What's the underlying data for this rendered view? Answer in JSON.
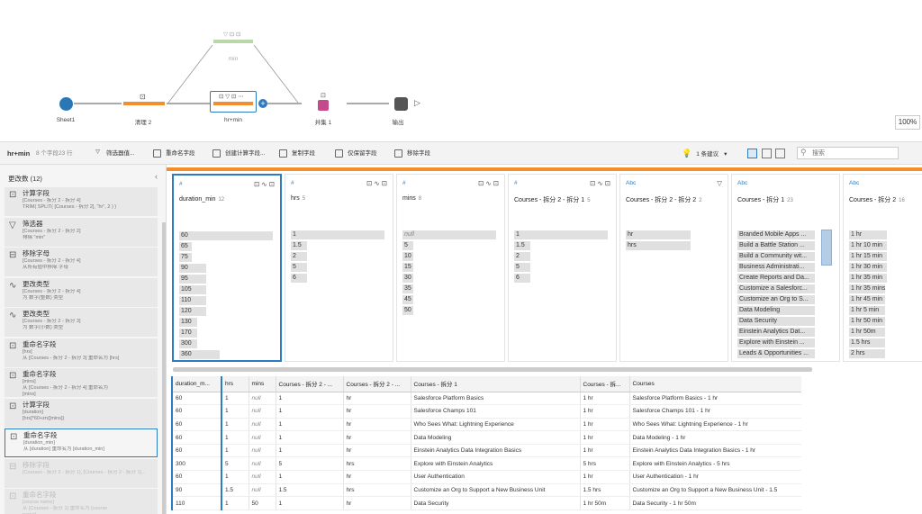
{
  "flow": {
    "nodes": [
      {
        "label": "Sheet1"
      },
      {
        "label": "清理 2"
      },
      {
        "label": "hr+min"
      },
      {
        "label": "并集 1"
      },
      {
        "label": "输出"
      },
      {
        "label": "min"
      }
    ],
    "zoom": "100%"
  },
  "toolbar": {
    "step_name": "hr+min",
    "field_count": "8 个字段",
    "row_count": "23 行",
    "buttons": [
      "筛选器值...",
      "重命名字段",
      "创建计算字段...",
      "复制字段",
      "仅保留字段",
      "移除字段"
    ],
    "suggestion": "1 条建议",
    "search_placeholder": "搜索"
  },
  "changes": {
    "title": "更改数 (12)",
    "items": [
      {
        "icon": "calc",
        "title": "计算字段",
        "sub": [
          "[Courses - 拆分 2 - 拆分 4]",
          "TRIM( SPLIT( [Courses - 拆分 2], \"hr\", 2 ) )"
        ]
      },
      {
        "icon": "filter",
        "title": "筛选器",
        "sub": [
          "[Courses - 拆分 2 - 拆分 2]",
          "排除 \"min\""
        ]
      },
      {
        "icon": "remove",
        "title": "移除字母",
        "sub": [
          "[Courses - 拆分 2 - 拆分 4]",
          "从所有值中移除 字母"
        ]
      },
      {
        "icon": "type",
        "title": "更改类型",
        "sub": [
          "[Courses - 拆分 2 - 拆分 4]",
          "为 数字(整数) 类型"
        ]
      },
      {
        "icon": "type",
        "title": "更改类型",
        "sub": [
          "[Courses - 拆分 2 - 拆分 3]",
          "为 数字(小数) 类型"
        ]
      },
      {
        "icon": "rename",
        "title": "重命名字段",
        "sub": [
          "[hrs]",
          "从 [Courses - 拆分 2 - 拆分 3] 重命名为 [hrs]"
        ]
      },
      {
        "icon": "rename",
        "title": "重命名字段",
        "sub": [
          "[mins]",
          "从 [Courses - 拆分 2 - 拆分 4] 重命名为",
          "[mins]"
        ]
      },
      {
        "icon": "calc",
        "title": "计算字段",
        "sub": [
          "[duration]",
          "[hrs]*60+zn([mins])"
        ]
      },
      {
        "icon": "rename",
        "title": "重命名字段",
        "sub": [
          "[duration_min]",
          "从 [duration] 重命名为 [duration_min]"
        ]
      },
      {
        "icon": "remove",
        "title": "移除字段",
        "sub": [
          "[Courses - 拆分 2 - 拆分 1], [Courses - 拆分 2 - 拆分 1]..."
        ]
      },
      {
        "icon": "rename",
        "title": "重命名字段",
        "sub": [
          "[course name]",
          "从 [Courses - 拆分 1] 重命名为 [course",
          "name]"
        ]
      }
    ]
  },
  "profile": [
    {
      "type": "#",
      "name": "duration_min",
      "count": "12",
      "values": [
        "60",
        "65",
        "75",
        "90",
        "95",
        "105",
        "110",
        "120",
        "130",
        "170",
        "300",
        "360"
      ]
    },
    {
      "type": "#",
      "name": "hrs",
      "count": "5",
      "values": [
        "1",
        "1.5",
        "2",
        "5",
        "6"
      ]
    },
    {
      "type": "#",
      "name": "mins",
      "count": "8",
      "values": [
        "null",
        "5",
        "10",
        "15",
        "30",
        "35",
        "45",
        "50"
      ]
    },
    {
      "type": "#",
      "name": "Courses - 拆分 2 - 拆分 1",
      "count": "5",
      "values": [
        "1",
        "1.5",
        "2",
        "5",
        "6"
      ]
    },
    {
      "type": "Abc",
      "name": "Courses - 拆分 2 - 拆分 2",
      "count": "2",
      "values": [
        "hr",
        "hrs"
      ]
    },
    {
      "type": "Abc",
      "name": "Courses - 拆分 1",
      "count": "23",
      "values": [
        "Branded Mobile Apps ...",
        "Build a Battle Station ...",
        "Build a Community wit...",
        "Business Administrati...",
        "Create Reports and Da...",
        "Customize a Salesforc...",
        "Customize an Org to S...",
        "Data Modeling",
        "Data Security",
        "Einstein Analytics Dat...",
        "Explore with Einstein ...",
        "Leads & Opportunities ..."
      ]
    },
    {
      "type": "Abc",
      "name": "Courses - 拆分 2",
      "count": "16",
      "values": [
        "1 hr",
        "1 hr 10 min",
        "1 hr 15 min",
        "1 hr 30 min",
        "1 hr 35 min",
        "1 hr 35 mins",
        "1 hr 45 min",
        "1 hr 5 min",
        "1 hr 50 min",
        "1 hr 50m",
        "1.5 hrs",
        "2 hrs"
      ]
    }
  ],
  "grid": {
    "headers": [
      "duration_m...",
      "hrs",
      "mins",
      "Courses - 拆分 2 - ...",
      "Courses - 拆分 2 - ...",
      "Courses - 拆分 1",
      "Courses - 拆...",
      "Courses"
    ],
    "rows": [
      [
        "60",
        "1",
        "null",
        "1",
        "hr",
        "Salesforce Platform Basics",
        "1 hr",
        "Salesforce Platform Basics - 1 hr"
      ],
      [
        "60",
        "1",
        "null",
        "1",
        "hr",
        "Salesforce Champs 101",
        "1 hr",
        "Salesforce Champs 101 - 1 hr"
      ],
      [
        "60",
        "1",
        "null",
        "1",
        "hr",
        "Who Sees What: Lightning Experience",
        "1 hr",
        "Who Sees What: Lightning Experience - 1 hr"
      ],
      [
        "60",
        "1",
        "null",
        "1",
        "hr",
        "Data Modeling",
        "1 hr",
        "Data Modeling - 1 hr"
      ],
      [
        "60",
        "1",
        "null",
        "1",
        "hr",
        "Einstein Analytics Data Integration Basics",
        "1 hr",
        "Einstein Analytics Data Integration Basics - 1 hr"
      ],
      [
        "300",
        "5",
        "null",
        "5",
        "hrs",
        "Explore with Einstein Analytics",
        "5 hrs",
        "Explore with Einstein Analytics - 5 hrs"
      ],
      [
        "60",
        "1",
        "null",
        "1",
        "hr",
        "User Authentication",
        "1 hr",
        "User Authentication - 1 hr"
      ],
      [
        "90",
        "1.5",
        "null",
        "1.5",
        "hrs",
        "Customize an Org to Support a New Business Unit",
        "1.5 hrs",
        "Customize an Org to Support a New Business Unit - 1.5"
      ],
      [
        "110",
        "1",
        "50",
        "1",
        "hr",
        "Data Security",
        "1 hr 50m",
        "Data Security - 1 hr 50m"
      ]
    ]
  }
}
